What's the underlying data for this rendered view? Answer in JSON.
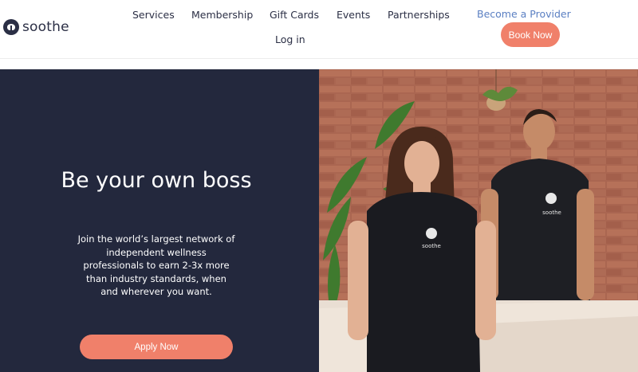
{
  "header": {
    "logo_text": "soothe",
    "nav": {
      "services": "Services",
      "membership": "Membership",
      "gift_cards": "Gift Cards",
      "events": "Events",
      "partnerships": "Partnerships",
      "login": "Log in",
      "provider": "Become a Provider"
    },
    "book_now": "Book Now"
  },
  "hero": {
    "title": "Be your own boss",
    "subtitle": "Join the world’s largest network of independent wellness professionals to earn 2-3x more than industry standards, when and wherever you want.",
    "apply_label": "Apply Now",
    "shirt_logo_text": "soothe"
  },
  "colors": {
    "navy": "#23283d",
    "coral": "#f0806a",
    "link_blue": "#5a7fc2"
  }
}
